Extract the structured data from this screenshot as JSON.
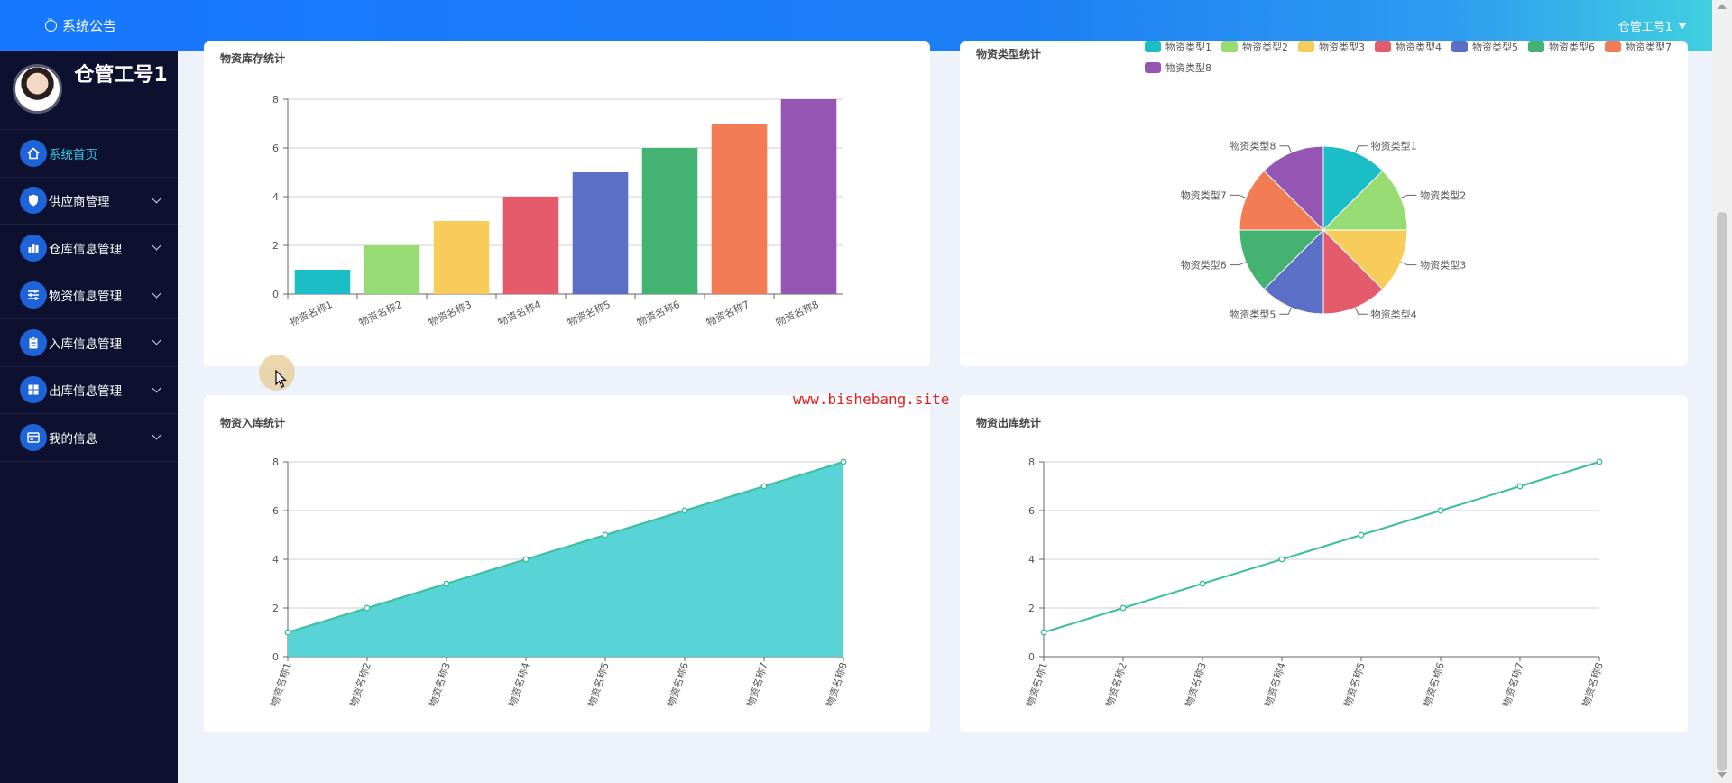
{
  "header": {
    "announcement": "系统公告",
    "user": "仓管工号1"
  },
  "watermark": "www.bishebang.site",
  "sidebar": {
    "profile_name": "仓管工号1",
    "items": [
      {
        "label": "系统首页",
        "icon": "home-icon"
      },
      {
        "label": "供应商管理",
        "icon": "shield-icon"
      },
      {
        "label": "仓库信息管理",
        "icon": "bar-chart-icon"
      },
      {
        "label": "物资信息管理",
        "icon": "sliders-icon"
      },
      {
        "label": "入库信息管理",
        "icon": "clipboard-icon"
      },
      {
        "label": "出库信息管理",
        "icon": "grid-icon"
      },
      {
        "label": "我的信息",
        "icon": "card-icon"
      }
    ]
  },
  "colors": {
    "accent": "#1677ff",
    "active_text": "#35c9e3",
    "sidebar_bg": "#0e1030",
    "palette": [
      "#1bbec6",
      "#97dc72",
      "#f7cc5b",
      "#e45b6c",
      "#5b6fc6",
      "#44b372",
      "#f27c54",
      "#9556b3"
    ]
  },
  "chart_data": [
    {
      "type": "bar",
      "title": "物资库存统计",
      "categories": [
        "物资名称1",
        "物资名称2",
        "物资名称3",
        "物资名称4",
        "物资名称5",
        "物资名称6",
        "物资名称7",
        "物资名称8"
      ],
      "values": [
        1,
        2,
        3,
        4,
        5,
        6,
        7,
        8
      ],
      "yticks": [
        "0",
        "2",
        "4",
        "6",
        "8"
      ],
      "ylim": [
        0,
        8
      ],
      "grid": true,
      "legend": "none"
    },
    {
      "type": "pie",
      "title": "物资类型统计",
      "labels": [
        "物资类型1",
        "物资类型2",
        "物资类型3",
        "物资类型4",
        "物资类型5",
        "物资类型6",
        "物资类型7",
        "物资类型8"
      ],
      "values": [
        1,
        1,
        1,
        1,
        1,
        1,
        1,
        1
      ],
      "legend": "top"
    },
    {
      "type": "area",
      "title": "物资入库统计",
      "categories": [
        "物资名称1",
        "物资名称2",
        "物资名称3",
        "物资名称4",
        "物资名称5",
        "物资名称6",
        "物资名称7",
        "物资名称8"
      ],
      "values": [
        1,
        2,
        3,
        4,
        5,
        6,
        7,
        8
      ],
      "yticks": [
        "0",
        "2",
        "4",
        "6",
        "8"
      ],
      "ylim": [
        0,
        8
      ],
      "grid": true
    },
    {
      "type": "line",
      "title": "物资出库统计",
      "categories": [
        "物资名称1",
        "物资名称2",
        "物资名称3",
        "物资名称4",
        "物资名称5",
        "物资名称6",
        "物资名称7",
        "物资名称8"
      ],
      "values": [
        1,
        2,
        3,
        4,
        5,
        6,
        7,
        8
      ],
      "yticks": [
        "0",
        "2",
        "4",
        "6",
        "8"
      ],
      "ylim": [
        0,
        8
      ],
      "grid": true
    }
  ]
}
